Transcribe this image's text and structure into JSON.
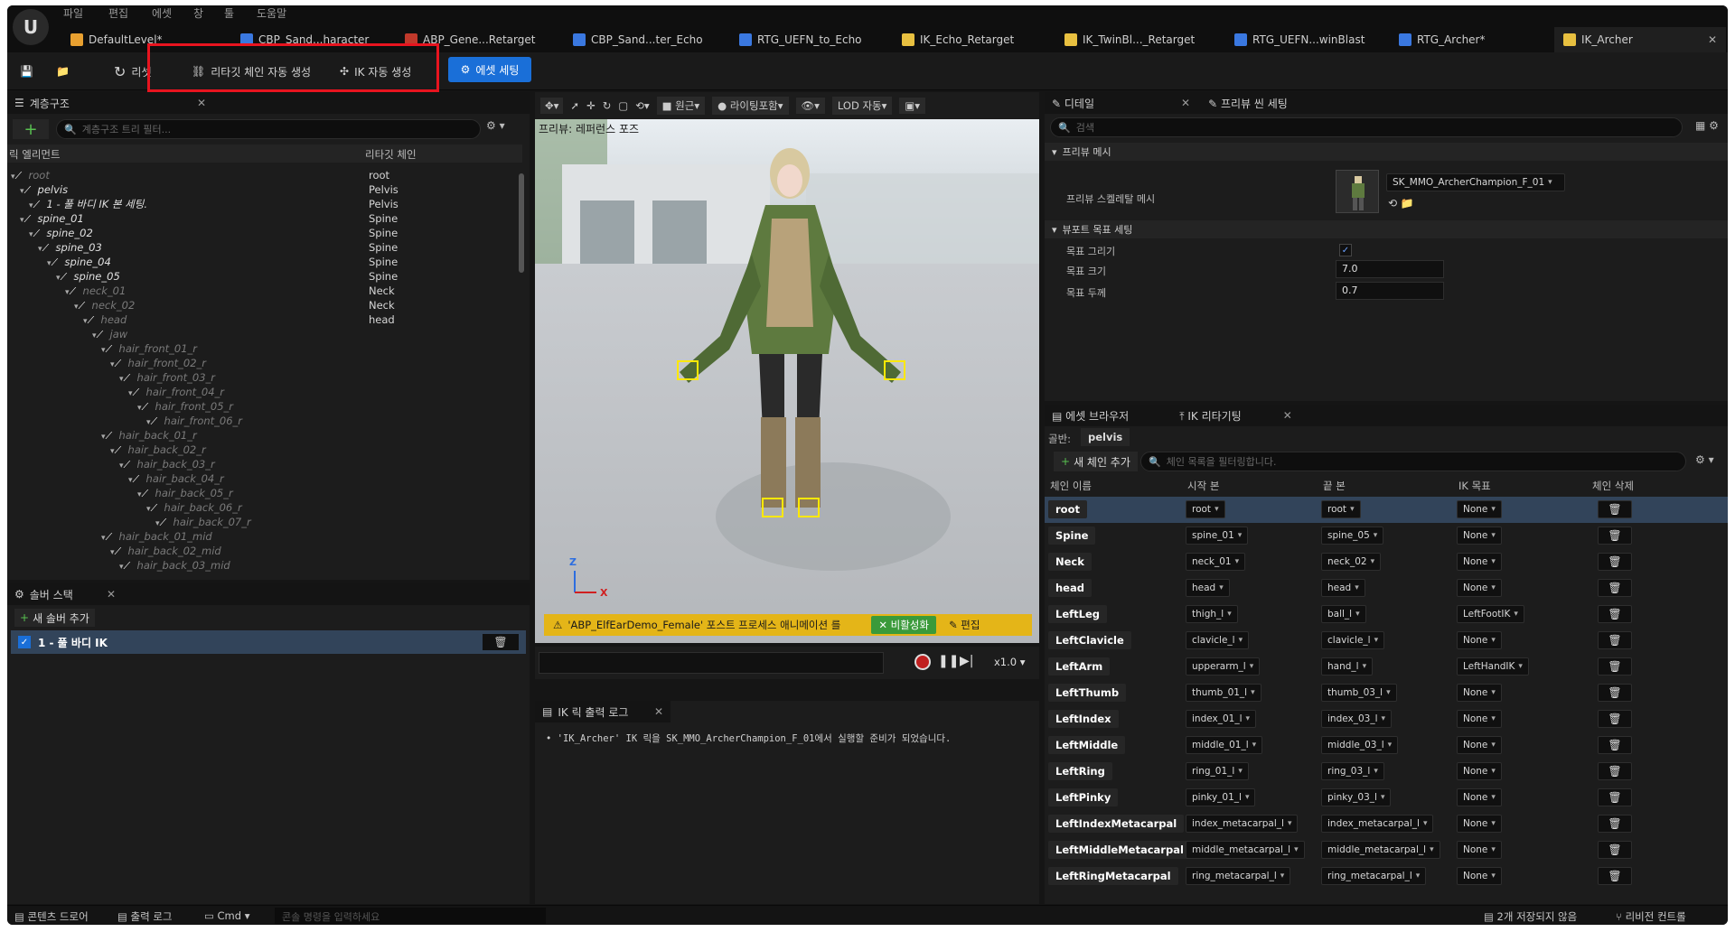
{
  "menu": [
    "파일",
    "편집",
    "에셋",
    "창",
    "툴",
    "도움말"
  ],
  "tabs": [
    {
      "label": "DefaultLevel*",
      "color": "#e8a030"
    },
    {
      "label": "CBP_Sand...haracter",
      "color": "#3a78e0"
    },
    {
      "label": "ABP_Gene...Retarget",
      "color": "#c0392b"
    },
    {
      "label": "CBP_Sand...ter_Echo",
      "color": "#3a78e0"
    },
    {
      "label": "RTG_UEFN_to_Echo",
      "color": "#3a78e0"
    },
    {
      "label": "IK_Echo_Retarget",
      "color": "#e8c040"
    },
    {
      "label": "IK_TwinBl..._Retarget",
      "color": "#e8c040"
    },
    {
      "label": "RTG_UEFN...winBlast",
      "color": "#3a78e0"
    },
    {
      "label": "RTG_Archer*",
      "color": "#3a78e0"
    },
    {
      "label": "IK_Archer",
      "color": "#e8c040"
    }
  ],
  "toolbar": {
    "reset": "리셋",
    "auto_retarget_chain": "리타깃 체인 자동 생성",
    "auto_ik": "IK 자동 생성",
    "asset_settings": "에셋 세팅"
  },
  "hierarchy": {
    "title": "계층구조",
    "search_placeholder": "계층구조 트리 필터...",
    "col_element": "릭 엘리먼트",
    "col_chain": "리타깃 체인",
    "rows": [
      {
        "name": "root",
        "chain": "root",
        "dim": true
      },
      {
        "name": "pelvis",
        "chain": "Pelvis",
        "dim": false
      },
      {
        "name": "1 - 풀 바디 IK 본 세팅.",
        "chain": "Pelvis",
        "dim": false
      },
      {
        "name": "spine_01",
        "chain": "Spine",
        "dim": false
      },
      {
        "name": "spine_02",
        "chain": "Spine",
        "dim": false
      },
      {
        "name": "spine_03",
        "chain": "Spine",
        "dim": false
      },
      {
        "name": "spine_04",
        "chain": "Spine",
        "dim": false
      },
      {
        "name": "spine_05",
        "chain": "Spine",
        "dim": false
      },
      {
        "name": "neck_01",
        "chain": "Neck",
        "dim": true
      },
      {
        "name": "neck_02",
        "chain": "Neck",
        "dim": true
      },
      {
        "name": "head",
        "chain": "head",
        "dim": true
      },
      {
        "name": "jaw",
        "chain": "",
        "dim": true
      },
      {
        "name": "hair_front_01_r",
        "chain": "",
        "dim": true
      },
      {
        "name": "hair_front_02_r",
        "chain": "",
        "dim": true
      },
      {
        "name": "hair_front_03_r",
        "chain": "",
        "dim": true
      },
      {
        "name": "hair_front_04_r",
        "chain": "",
        "dim": true
      },
      {
        "name": "hair_front_05_r",
        "chain": "",
        "dim": true
      },
      {
        "name": "hair_front_06_r",
        "chain": "",
        "dim": true
      },
      {
        "name": "hair_back_01_r",
        "chain": "",
        "dim": true
      },
      {
        "name": "hair_back_02_r",
        "chain": "",
        "dim": true
      },
      {
        "name": "hair_back_03_r",
        "chain": "",
        "dim": true
      },
      {
        "name": "hair_back_04_r",
        "chain": "",
        "dim": true
      },
      {
        "name": "hair_back_05_r",
        "chain": "",
        "dim": true
      },
      {
        "name": "hair_back_06_r",
        "chain": "",
        "dim": true
      },
      {
        "name": "hair_back_07_r",
        "chain": "",
        "dim": true
      },
      {
        "name": "hair_back_01_mid",
        "chain": "",
        "dim": true
      },
      {
        "name": "hair_back_02_mid",
        "chain": "",
        "dim": true
      },
      {
        "name": "hair_back_03_mid",
        "chain": "",
        "dim": true
      }
    ]
  },
  "solver": {
    "title": "솔버 스택",
    "add": "새 솔버 추가",
    "item": "1 - 풀 바디 IK"
  },
  "viewport": {
    "toolbar_perspective": "원근",
    "toolbar_lighting": "라이팅포함",
    "toolbar_lod": "LOD 자동",
    "label": "프리뷰: 레퍼런스 포즈",
    "warning": "'ABP_ElfEarDemo_Female' 포스트 프로세스 애니메이션 를",
    "disable": "비활성화",
    "edit": "편집",
    "speed": "x1.0",
    "axis_z": "Z",
    "axis_x": "X"
  },
  "log": {
    "title": "IK 릭 출력 로그",
    "line": "'IK_Archer' IK 릭을 SK_MMO_ArcherChampion_F_01에서 실행할 준비가 되었습니다."
  },
  "details": {
    "tab1": "디테일",
    "tab2": "프리뷰 씬 세팅",
    "search_placeholder": "검색",
    "section1": "프리뷰 메시",
    "mesh_label": "프리뷰 스켈레탈 메시",
    "mesh_value": "SK_MMO_ArcherChampion_F_01",
    "section2": "뷰포트 목표 세팅",
    "draw_goal": "목표 그리기",
    "goal_size_label": "목표 크기",
    "goal_size": "7.0",
    "goal_thick_label": "목표 두께",
    "goal_thick": "0.7"
  },
  "retarget": {
    "tab1": "에셋 브라우저",
    "tab2": "IK 리타기팅",
    "root_label": "골반:",
    "root_value": "pelvis",
    "add_chain": "새 체인 추가",
    "filter_placeholder": "체인 목록을 필터링합니다.",
    "headers": [
      "체인 이름",
      "시작 본",
      "끝 본",
      "IK 목표",
      "체인 삭제"
    ],
    "chains": [
      {
        "name": "root",
        "start": "root",
        "end": "root",
        "goal": "None"
      },
      {
        "name": "Spine",
        "start": "spine_01",
        "end": "spine_05",
        "goal": "None"
      },
      {
        "name": "Neck",
        "start": "neck_01",
        "end": "neck_02",
        "goal": "None"
      },
      {
        "name": "head",
        "start": "head",
        "end": "head",
        "goal": "None"
      },
      {
        "name": "LeftLeg",
        "start": "thigh_l",
        "end": "ball_l",
        "goal": "LeftFootIK"
      },
      {
        "name": "LeftClavicle",
        "start": "clavicle_l",
        "end": "clavicle_l",
        "goal": "None"
      },
      {
        "name": "LeftArm",
        "start": "upperarm_l",
        "end": "hand_l",
        "goal": "LeftHandIK"
      },
      {
        "name": "LeftThumb",
        "start": "thumb_01_l",
        "end": "thumb_03_l",
        "goal": "None"
      },
      {
        "name": "LeftIndex",
        "start": "index_01_l",
        "end": "index_03_l",
        "goal": "None"
      },
      {
        "name": "LeftMiddle",
        "start": "middle_01_l",
        "end": "middle_03_l",
        "goal": "None"
      },
      {
        "name": "LeftRing",
        "start": "ring_01_l",
        "end": "ring_03_l",
        "goal": "None"
      },
      {
        "name": "LeftPinky",
        "start": "pinky_01_l",
        "end": "pinky_03_l",
        "goal": "None"
      },
      {
        "name": "LeftIndexMetacarpal",
        "start": "index_metacarpal_l",
        "end": "index_metacarpal_l",
        "goal": "None"
      },
      {
        "name": "LeftMiddleMetacarpal",
        "start": "middle_metacarpal_l",
        "end": "middle_metacarpal_l",
        "goal": "None"
      },
      {
        "name": "LeftRingMetacarpal",
        "start": "ring_metacarpal_l",
        "end": "ring_metacarpal_l",
        "goal": "None"
      }
    ]
  },
  "statusbar": {
    "content_drawer": "콘텐츠 드로어",
    "output_log": "출력 로그",
    "cmd": "Cmd",
    "cmd_placeholder": "콘솔 명령을 입력하세요",
    "unsaved": "2개 저장되지 않음",
    "revision": "리비전 컨트롤"
  }
}
